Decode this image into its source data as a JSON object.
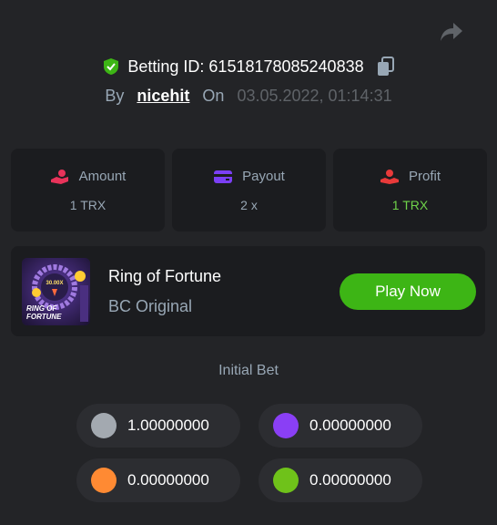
{
  "header": {
    "betting_id_label": "Betting ID: 61518178085240838",
    "by_label": "By",
    "username": "nicehit",
    "on_label": "On",
    "datetime": "03.05.2022, 01:14:31"
  },
  "stats": [
    {
      "label": "Amount",
      "value": "1 TRX",
      "icon": "coins-hand-icon"
    },
    {
      "label": "Payout",
      "value": "2 x",
      "icon": "wallet-icon"
    },
    {
      "label": "Profit",
      "value": "1 TRX",
      "icon": "profit-hand-icon"
    }
  ],
  "game": {
    "name": "Ring of Fortune",
    "subtitle": "BC Original",
    "play_label": "Play Now",
    "thumb_text_line1": "RING OF",
    "thumb_text_line2": "FORTUNE",
    "thumb_multiplier": "30.00X"
  },
  "initial_bet": {
    "label": "Initial Bet",
    "coins": [
      {
        "value": "1.00000000",
        "color": "#a3a9b0"
      },
      {
        "value": "0.00000000",
        "color": "#8a3ff5"
      },
      {
        "value": "0.00000000",
        "color": "#ff8a33"
      },
      {
        "value": "0.00000000",
        "color": "#6fc21a"
      }
    ]
  },
  "colors": {
    "accent_green": "#3db515",
    "profit_green": "#6fd34a",
    "shield_green": "#3db515",
    "amount_icon": "#e8335a",
    "payout_icon": "#7b3ff5",
    "profit_icon": "#e83a3a"
  }
}
